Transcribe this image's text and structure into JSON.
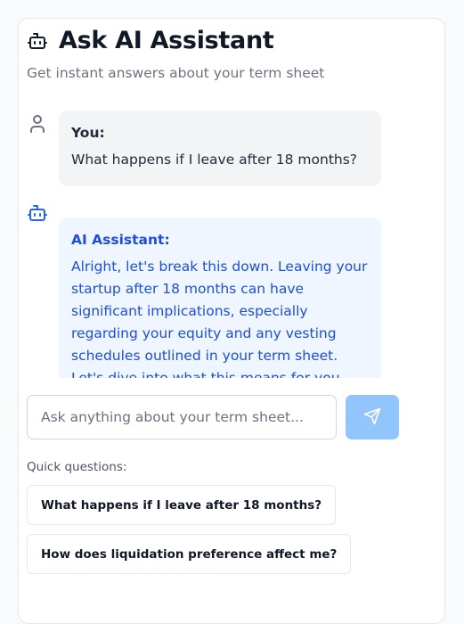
{
  "header": {
    "icon": "bot-icon",
    "title": "Ask AI Assistant",
    "subtitle": "Get instant answers about your term sheet"
  },
  "chat": {
    "messages": [
      {
        "role": "user",
        "icon": "user-icon",
        "sender": "You:",
        "text": "What happens if I leave after 18 months?"
      },
      {
        "role": "assistant",
        "icon": "bot-icon",
        "sender": "AI Assistant:",
        "text": "Alright, let's break this down. Leaving your startup after 18 months can have significant implications, especially regarding your equity and any vesting schedules outlined in your term sheet. Let's dive into what this means for you."
      }
    ]
  },
  "input": {
    "placeholder": "Ask anything about your term sheet...",
    "value": "",
    "send_icon": "send-icon"
  },
  "quick_questions": {
    "label": "Quick questions:",
    "items": [
      "What happens if I leave after 18 months?",
      "How does liquidation preference affect me?"
    ]
  },
  "colors": {
    "accent": "#1d4ed8",
    "ai_bubble": "#eff6ff",
    "user_bubble": "#f3f4f6",
    "send_button": "#93c5fd"
  }
}
